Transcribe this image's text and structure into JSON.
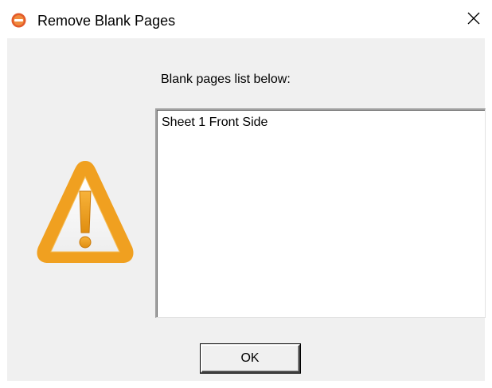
{
  "window": {
    "title": "Remove Blank Pages",
    "icon": "app-logo-icon",
    "close_icon": "close-icon"
  },
  "dialog": {
    "list_label": "Blank pages list below:",
    "items": [
      "Sheet 1 Front Side"
    ],
    "warning_icon": "warning-icon",
    "ok_label": "OK"
  },
  "colors": {
    "warning_orange": "#f0a020",
    "dialog_background": "#f0f0f0",
    "app_icon_red": "#e04a2a"
  }
}
